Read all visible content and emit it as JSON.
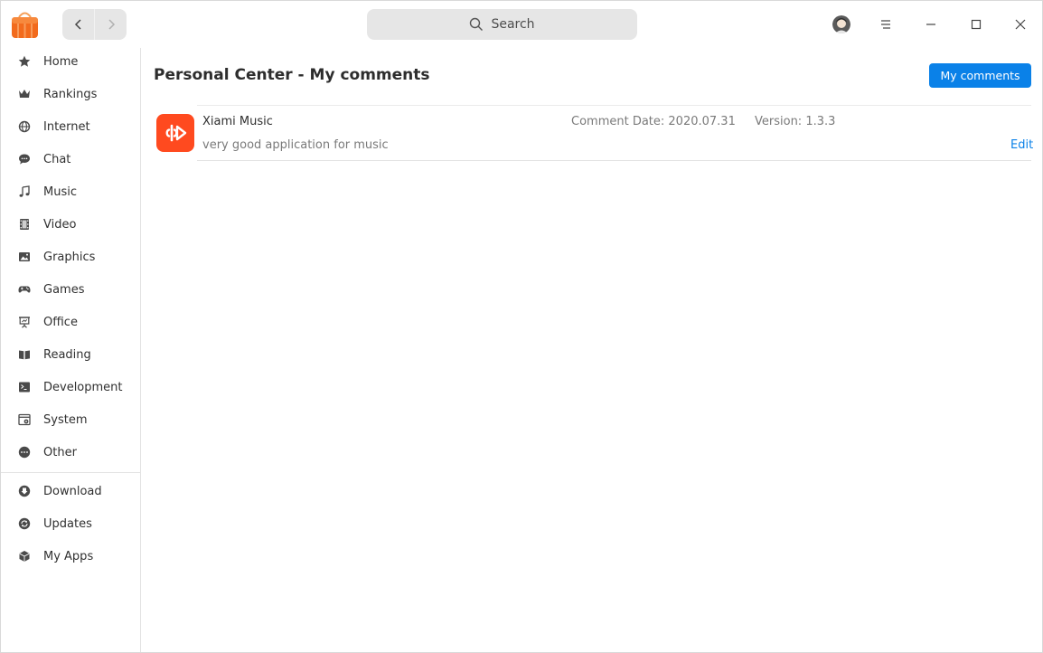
{
  "header": {
    "search_placeholder": "Search"
  },
  "sidebar": {
    "items": [
      {
        "label": "Home",
        "icon": "star-icon"
      },
      {
        "label": "Rankings",
        "icon": "crown-icon"
      },
      {
        "label": "Internet",
        "icon": "globe-icon"
      },
      {
        "label": "Chat",
        "icon": "chat-bubble-icon"
      },
      {
        "label": "Music",
        "icon": "music-note-icon"
      },
      {
        "label": "Video",
        "icon": "film-icon"
      },
      {
        "label": "Graphics",
        "icon": "image-icon"
      },
      {
        "label": "Games",
        "icon": "gamepad-icon"
      },
      {
        "label": "Office",
        "icon": "presentation-icon"
      },
      {
        "label": "Reading",
        "icon": "book-icon"
      },
      {
        "label": "Development",
        "icon": "terminal-icon"
      },
      {
        "label": "System",
        "icon": "system-window-icon"
      },
      {
        "label": "Other",
        "icon": "more-dots-icon"
      }
    ],
    "bottom_items": [
      {
        "label": "Download",
        "icon": "download-icon"
      },
      {
        "label": "Updates",
        "icon": "refresh-icon"
      },
      {
        "label": "My Apps",
        "icon": "cube-icon"
      }
    ]
  },
  "main": {
    "title": "Personal Center - My comments",
    "action_button": "My comments",
    "comments": [
      {
        "app_name": "Xiami Music",
        "comment": "very good application for music",
        "date": "Comment Date: 2020.07.31",
        "version": "Version: 1.3.3",
        "edit_label": "Edit"
      }
    ]
  },
  "colors": {
    "accent": "#0a81e8",
    "app_icon_bg": "#ff4a1f",
    "logo_orange": "#f26b1d"
  }
}
